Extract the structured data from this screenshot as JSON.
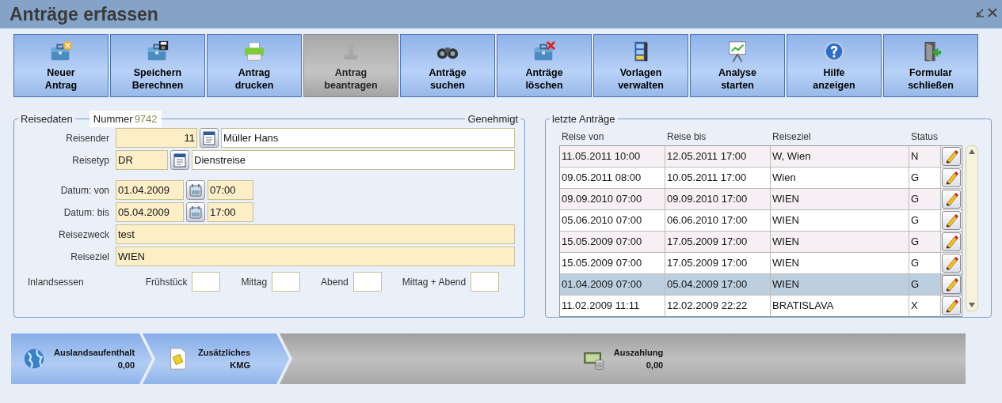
{
  "window": {
    "title": "Anträge erfassen"
  },
  "toolbar": [
    {
      "label": "Neuer\nAntrag",
      "disabled": false
    },
    {
      "label": "Speichern\nBerechnen",
      "disabled": false
    },
    {
      "label": "Antrag\ndrucken",
      "disabled": false
    },
    {
      "label": "Antrag\nbeantragen",
      "disabled": true
    },
    {
      "label": "Anträge\nsuchen",
      "disabled": false
    },
    {
      "label": "Anträge\nlöschen",
      "disabled": false
    },
    {
      "label": "Vorlagen\nverwalten",
      "disabled": false
    },
    {
      "label": "Analyse\nstarten",
      "disabled": false
    },
    {
      "label": "Hilfe\nanzeigen",
      "disabled": false
    },
    {
      "label": "Formular\nschließen",
      "disabled": false
    }
  ],
  "reisedaten": {
    "legend": "Reisedaten",
    "number_label": "Nummer",
    "number": "9742",
    "status": "Genehmigt",
    "reisender": {
      "label": "Reisender",
      "code": "11",
      "name": "Müller Hans"
    },
    "reisetyp": {
      "label": "Reisetyp",
      "code": "DR",
      "name": "Dienstreise"
    },
    "datum_von": {
      "label": "Datum: von",
      "date": "01.04.2009",
      "time": "07:00"
    },
    "datum_bis": {
      "label": "Datum: bis",
      "date": "05.04.2009",
      "time": "17:00"
    },
    "reisezweck": {
      "label": "Reisezweck",
      "value": "test"
    },
    "reiseziel": {
      "label": "Reiseziel",
      "value": "WIEN"
    },
    "inlandsessen": {
      "label": "Inlandsessen",
      "fields": [
        "Frühstück",
        "Mittag",
        "Abend",
        "Mittag + Abend"
      ]
    }
  },
  "letzte_antraege": {
    "legend": "letzte Anträge",
    "columns": [
      "Reise von",
      "Reise bis",
      "Reiseziel",
      "Status"
    ],
    "rows": [
      {
        "cells": [
          "11.05.2011 10:00",
          "12.05.2011 17:00",
          "W, Wien",
          "N"
        ],
        "selected": false
      },
      {
        "cells": [
          "09.05.2011 08:00",
          "10.05.2011 17:00",
          "Wien",
          "G"
        ],
        "selected": false
      },
      {
        "cells": [
          "09.09.2010 07:00",
          "09.09.2010 17:00",
          "WIEN",
          "G"
        ],
        "selected": false
      },
      {
        "cells": [
          "05.06.2010 07:00",
          "06.06.2010 17:00",
          "WIEN",
          "G"
        ],
        "selected": false
      },
      {
        "cells": [
          "15.05.2009 07:00",
          "17.05.2009 17:00",
          "WIEN",
          "G"
        ],
        "selected": false
      },
      {
        "cells": [
          "15.05.2009 07:00",
          "17.05.2009 17:00",
          "WIEN",
          "G"
        ],
        "selected": false
      },
      {
        "cells": [
          "01.04.2009 07:00",
          "05.04.2009 17:00",
          "WIEN",
          "G"
        ],
        "selected": true
      },
      {
        "cells": [
          "11.02.2009 11:11",
          "12.02.2009 22:22",
          "BRATISLAVA",
          "X"
        ],
        "selected": false
      }
    ]
  },
  "steps": [
    {
      "title": "Auslandsaufenthalt",
      "value": "0,00",
      "active": true
    },
    {
      "title": "Zusätzliches",
      "value": "KMG",
      "active": true
    },
    {
      "title": "Auszahlung",
      "value": "0,00",
      "active": false
    }
  ]
}
